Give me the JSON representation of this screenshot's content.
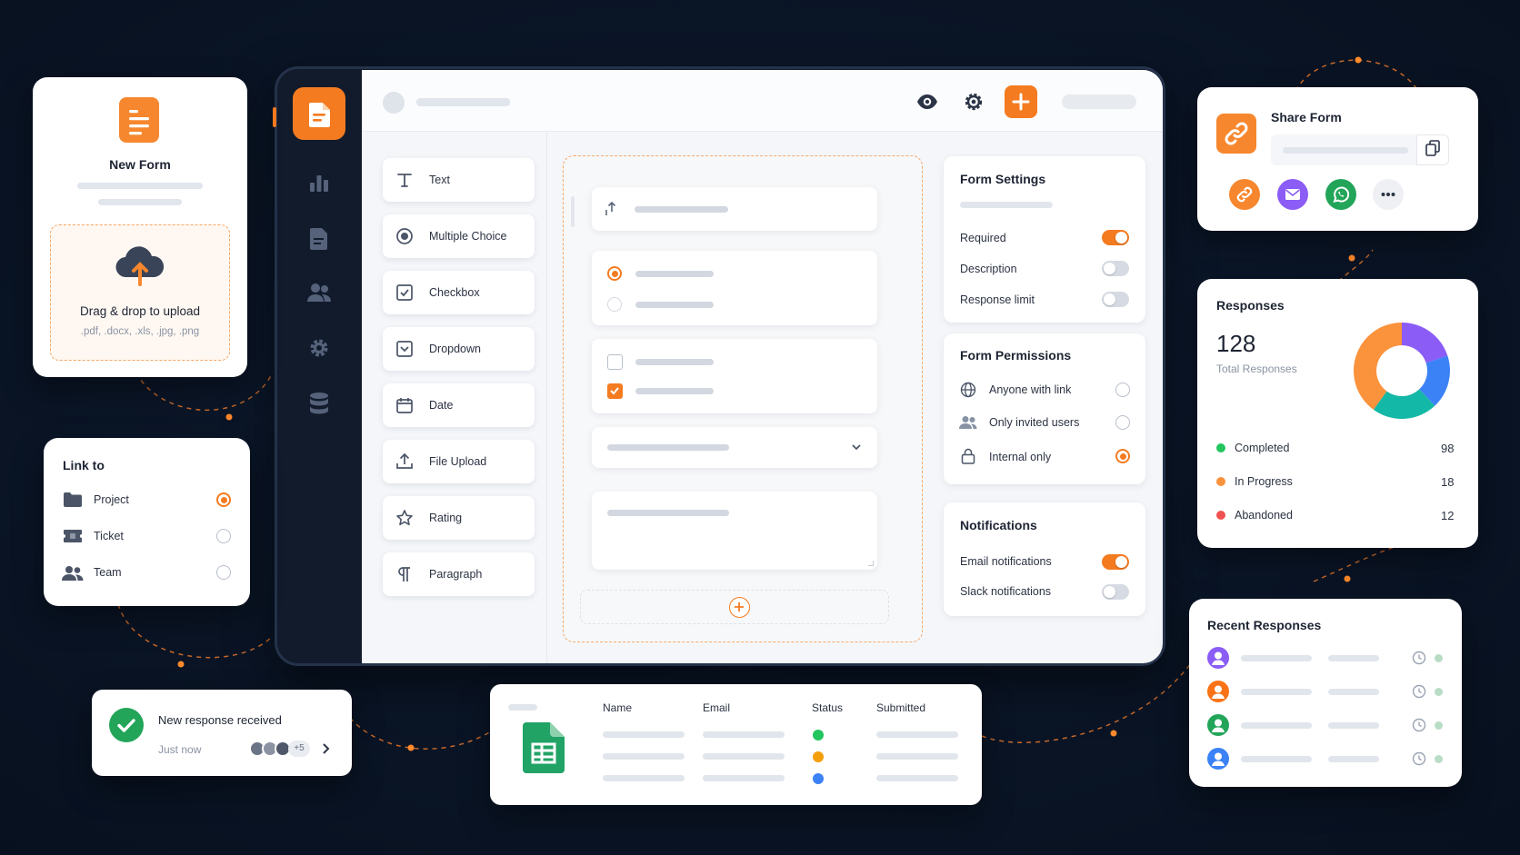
{
  "new_form": {
    "title": "New Form",
    "upload_title": "Drag & drop to upload",
    "upload_formats": ".pdf, .docx, .xls, .jpg, .png"
  },
  "link_to": {
    "title": "Link to",
    "items": [
      {
        "label": "Project",
        "icon": "folder-icon",
        "selected": true
      },
      {
        "label": "Ticket",
        "icon": "ticket-icon",
        "selected": false
      },
      {
        "label": "Team",
        "icon": "team-icon",
        "selected": false
      }
    ]
  },
  "notification": {
    "title": "New response received",
    "time": "Just now",
    "extra_count": "+5"
  },
  "sidebar": {
    "items": [
      "form-logo-icon",
      "chart-icon",
      "document-icon",
      "users-icon",
      "gear-icon",
      "database-icon"
    ]
  },
  "toolbar": {
    "icons": [
      "eye-icon",
      "gear-icon",
      "plus-icon"
    ]
  },
  "tools": [
    {
      "label": "Text",
      "icon": "text-icon"
    },
    {
      "label": "Multiple Choice",
      "icon": "radio-icon"
    },
    {
      "label": "Checkbox",
      "icon": "checkbox-icon"
    },
    {
      "label": "Dropdown",
      "icon": "dropdown-icon"
    },
    {
      "label": "Date",
      "icon": "calendar-icon"
    },
    {
      "label": "File Upload",
      "icon": "upload-icon"
    },
    {
      "label": "Rating",
      "icon": "star-icon"
    },
    {
      "label": "Paragraph",
      "icon": "paragraph-icon"
    }
  ],
  "form_settings": {
    "title": "Form Settings",
    "items": [
      {
        "label": "Required",
        "on": true
      },
      {
        "label": "Description",
        "on": false
      },
      {
        "label": "Response limit",
        "on": false
      }
    ]
  },
  "form_permissions": {
    "title": "Form Permissions",
    "items": [
      {
        "label": "Anyone with link",
        "icon": "globe-icon",
        "selected": false
      },
      {
        "label": "Only invited users",
        "icon": "users-icon",
        "selected": false
      },
      {
        "label": "Internal only",
        "icon": "lock-icon",
        "selected": true
      }
    ]
  },
  "notifications": {
    "title": "Notifications",
    "items": [
      {
        "label": "Email notifications",
        "on": true
      },
      {
        "label": "Slack notifications",
        "on": false
      }
    ]
  },
  "share_form": {
    "title": "Share Form",
    "channels": [
      "link-icon",
      "email-icon",
      "whatsapp-icon",
      "more-icon"
    ]
  },
  "responses": {
    "title": "Responses",
    "total": "128",
    "total_label": "Total Responses",
    "stats": [
      {
        "label": "Completed",
        "value": "98",
        "color": "#22c55e"
      },
      {
        "label": "In Progress",
        "value": "18",
        "color": "#fb923c"
      },
      {
        "label": "Abandoned",
        "value": "12",
        "color": "#f05252"
      }
    ]
  },
  "chart_data": {
    "type": "pie",
    "categories": [
      "orange",
      "purple",
      "blue",
      "teal"
    ],
    "values": [
      40,
      20,
      18,
      22
    ],
    "colors": [
      "#fb923c",
      "#8b5cf6",
      "#3b82f6",
      "#14b8a6"
    ]
  },
  "recent": {
    "title": "Recent Responses",
    "avatar_colors": [
      "#8b5cf6",
      "#f97316",
      "#22a559",
      "#3b82f6"
    ]
  },
  "sheet": {
    "columns": [
      "Name",
      "Email",
      "Status",
      "Submitted"
    ],
    "status_colors": [
      "#22c55e",
      "#f59e0b",
      "#3b82f6"
    ]
  },
  "colors": {
    "accent": "#f47b20",
    "background": "#0b1628"
  }
}
